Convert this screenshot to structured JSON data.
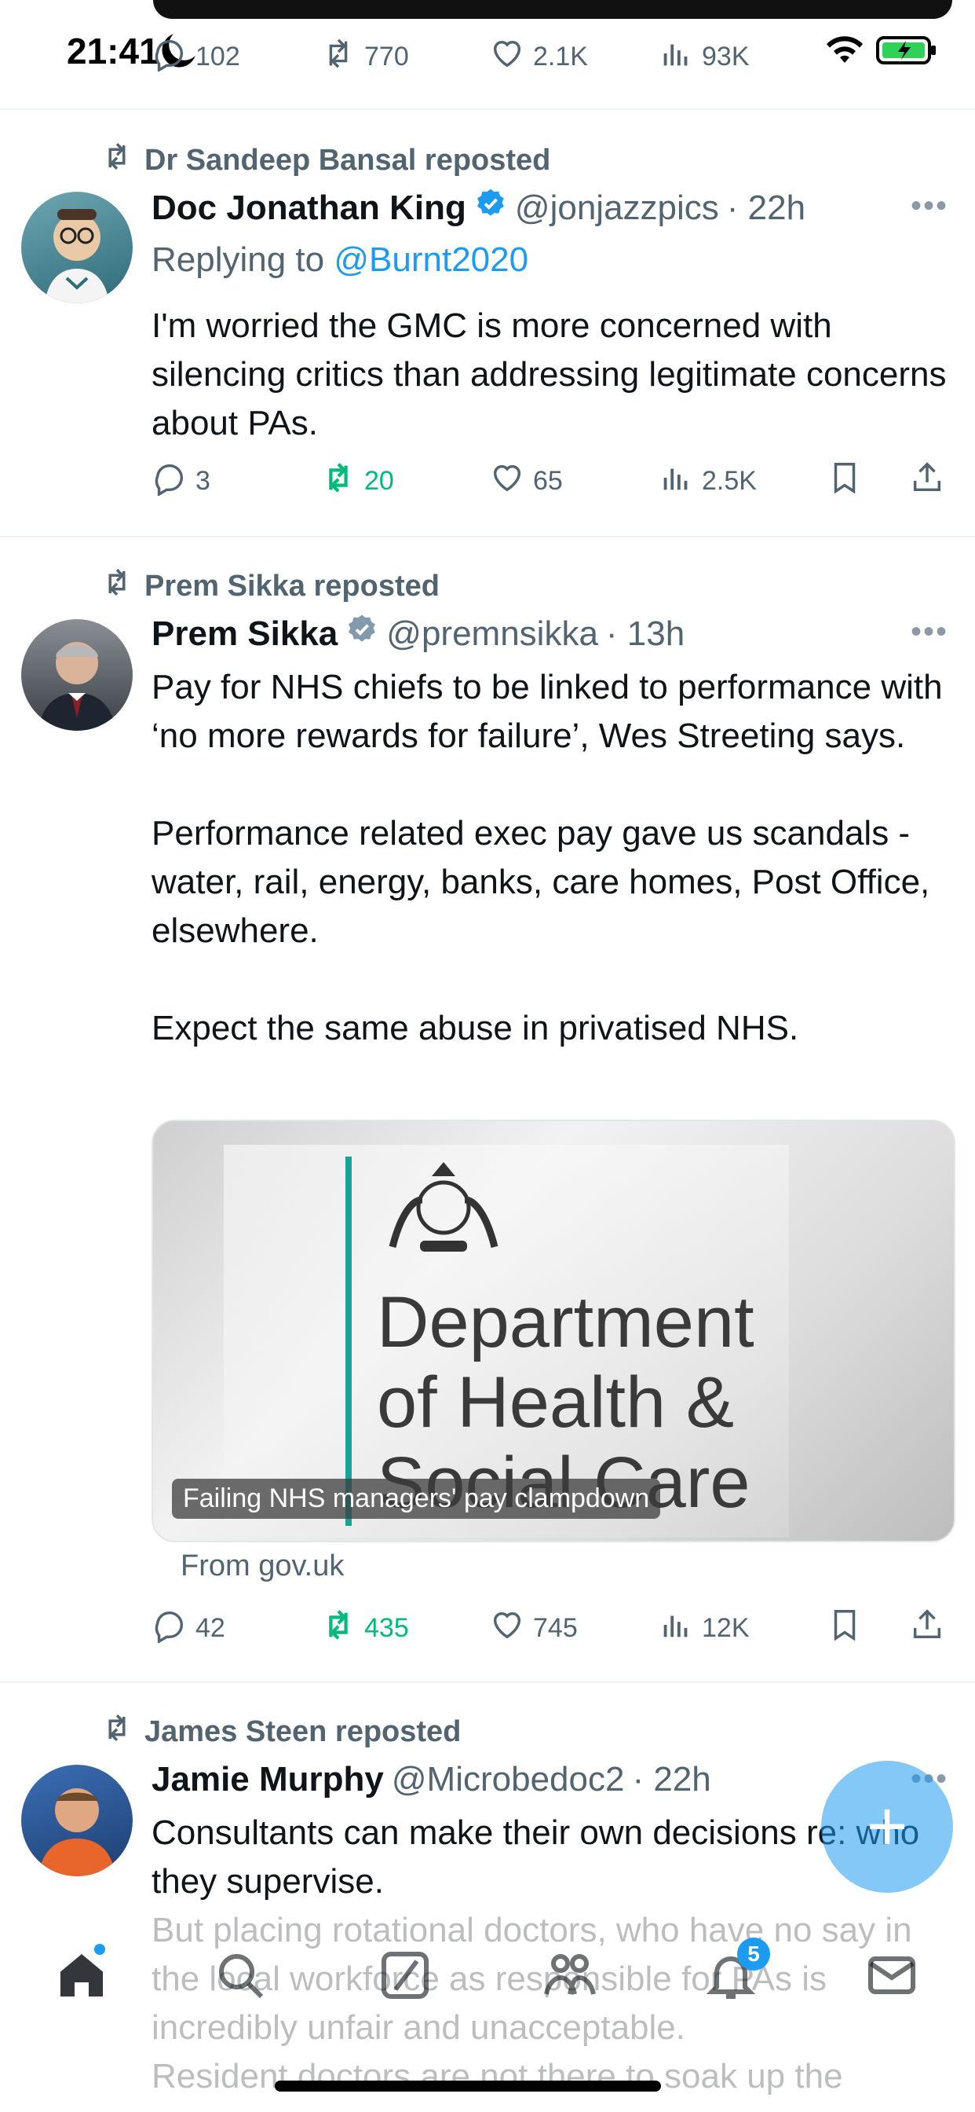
{
  "status_bar": {
    "time": "21:41"
  },
  "top_tweet_actions": {
    "replies": "102",
    "reposts": "770",
    "likes": "2.1K",
    "views": "93K"
  },
  "tweets": [
    {
      "repost_by": "Dr Sandeep Bansal reposted",
      "name": "Doc Jonathan King",
      "handle": "@jonjazzpics",
      "time": "· 22h",
      "reply_prefix": "Replying to",
      "reply_to": "@Burnt2020",
      "text": "I'm worried the GMC is more concerned with silencing critics than addressing legitimate concerns about PAs.",
      "actions": {
        "replies": "3",
        "reposts": "20",
        "likes": "65",
        "views": "2.5K"
      }
    },
    {
      "repost_by": "Prem Sikka reposted",
      "name": "Prem Sikka",
      "handle": "@premnsikka",
      "time": "· 13h",
      "text": "Pay for NHS chiefs to be linked to performance with ‘no more rewards for failure’, Wes Streeting says.\n\nPerformance related exec pay gave us scandals -water, rail, energy, banks, care homes, Post Office, elsewhere.\n\nExpect the same abuse in privatised NHS.",
      "card": {
        "image_text": "Department\nof Health &\nSocial Care",
        "caption": "Failing NHS managers' pay clampdown",
        "from": "From gov.uk"
      },
      "actions": {
        "replies": "42",
        "reposts": "435",
        "likes": "745",
        "views": "12K"
      }
    },
    {
      "repost_by": "James Steen reposted",
      "name": "Jamie Murphy",
      "handle": "@Microbedoc2",
      "time": "· 22h",
      "text": "Consultants can make their own decisions re: who they supervise.\nBut placing rotational doctors, who have no say in the local workforce as responsible for PAs is incredibly unfair and unacceptable.\nResident doctors are not there to soak up the"
    }
  ],
  "fab": {
    "icon": "+"
  },
  "bottom_nav": {
    "messages_badge": "5"
  },
  "colors": {
    "accent": "#1d9bf0",
    "repost_green": "#00ba7c",
    "muted": "#536471"
  }
}
